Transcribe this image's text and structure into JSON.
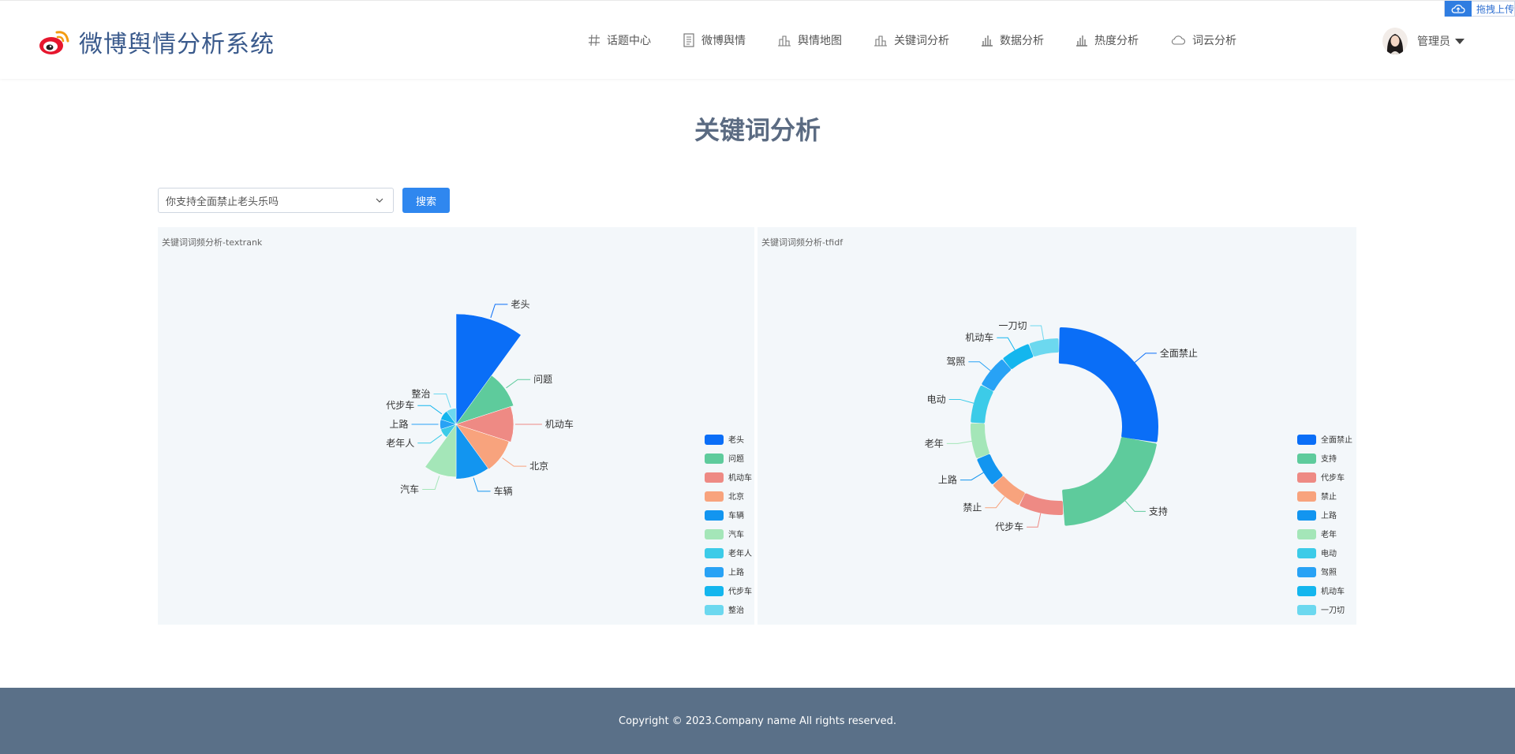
{
  "brand": {
    "title": "微博舆情分析系统"
  },
  "nav": {
    "items": [
      {
        "label": "话题中心",
        "icon": "hash-icon"
      },
      {
        "label": "微博舆情",
        "icon": "document-icon"
      },
      {
        "label": "舆情地图",
        "icon": "buildings-icon"
      },
      {
        "label": "关键词分析",
        "icon": "buildings-icon"
      },
      {
        "label": "数据分析",
        "icon": "bar-chart-icon"
      },
      {
        "label": "热度分析",
        "icon": "bar-chart-icon"
      },
      {
        "label": "词云分析",
        "icon": "cloud-icon"
      }
    ]
  },
  "user": {
    "name": "管理员"
  },
  "upload": {
    "label": "拖拽上传"
  },
  "page": {
    "title": "关键词分析"
  },
  "search": {
    "selected": "你支持全面禁止老头乐吗",
    "button_label": "搜索"
  },
  "footer": {
    "text": "Copyright © 2023.Company name All rights reserved."
  },
  "colors": {
    "accent": "#2f87ef",
    "footer": "#5a7088",
    "series": [
      "#0a6ef7",
      "#5ecb9c",
      "#ee8a84",
      "#f8a37d",
      "#1295f0",
      "#a4e6b8",
      "#3ccbe8",
      "#28a2f5",
      "#14b6ee",
      "#6cd8ef"
    ]
  },
  "chart_data": [
    {
      "type": "pie",
      "variant": "rose",
      "title": "关键词词频分析-textrank",
      "categories": [
        "老头",
        "问题",
        "机动车",
        "北京",
        "车辆",
        "汽车",
        "老年人",
        "上路",
        "代步车",
        "整治"
      ],
      "values": [
        100,
        48,
        45,
        43,
        42,
        40,
        2,
        2,
        2,
        2
      ],
      "legend_position": "bottom-right"
    },
    {
      "type": "pie",
      "variant": "donut",
      "title": "关键词词频分析-tfidf",
      "categories": [
        "全面禁止",
        "支持",
        "代步车",
        "禁止",
        "上路",
        "老年",
        "电动",
        "驾照",
        "机动车",
        "一刀切"
      ],
      "values": [
        100,
        78,
        30,
        22,
        20,
        24,
        26,
        22,
        20,
        20
      ],
      "legend_position": "bottom-right"
    }
  ]
}
